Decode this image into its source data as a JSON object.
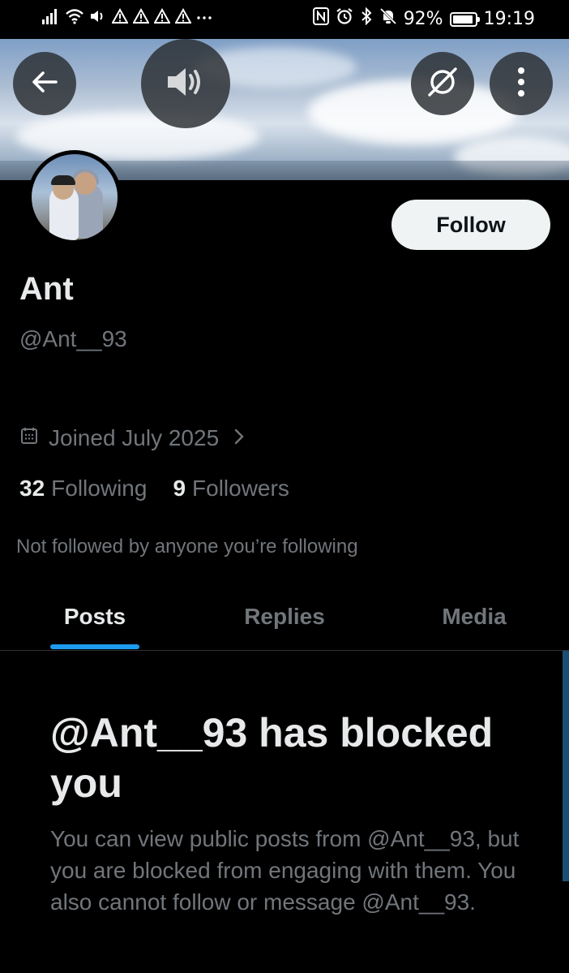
{
  "status_bar": {
    "left_icons": [
      "signal-icon",
      "wifi-icon",
      "volume-icon",
      "warning-icon",
      "warning-icon",
      "warning-icon",
      "warning-icon",
      "more-dots-icon"
    ],
    "right_icons": [
      "nfc-icon",
      "alarm-icon",
      "bluetooth-icon",
      "mute-icon"
    ],
    "battery_percent": "92%",
    "battery_level": 0.92,
    "time": "19:19"
  },
  "profile": {
    "name": "Ant",
    "handle": "@Ant__93",
    "joined": "Joined July 2025",
    "following_count": "32",
    "following_label": "Following",
    "followers_count": "9",
    "followers_label": "Followers",
    "not_followed_note": "Not followed by anyone you’re following"
  },
  "actions": {
    "follow_label": "Follow"
  },
  "tabs": [
    {
      "label": "Posts",
      "active": true
    },
    {
      "label": "Replies",
      "active": false
    },
    {
      "label": "Media",
      "active": false
    }
  ],
  "blocked": {
    "title": "@Ant__93 has blocked you",
    "body": "You can view public posts from @Ant__93, but you are blocked from engaging with them. You also cannot follow or message @Ant__93."
  },
  "colors": {
    "background": "#000000",
    "accent": "#1d9bf0",
    "text_primary": "#e7e9ea",
    "text_secondary": "#71767b"
  }
}
